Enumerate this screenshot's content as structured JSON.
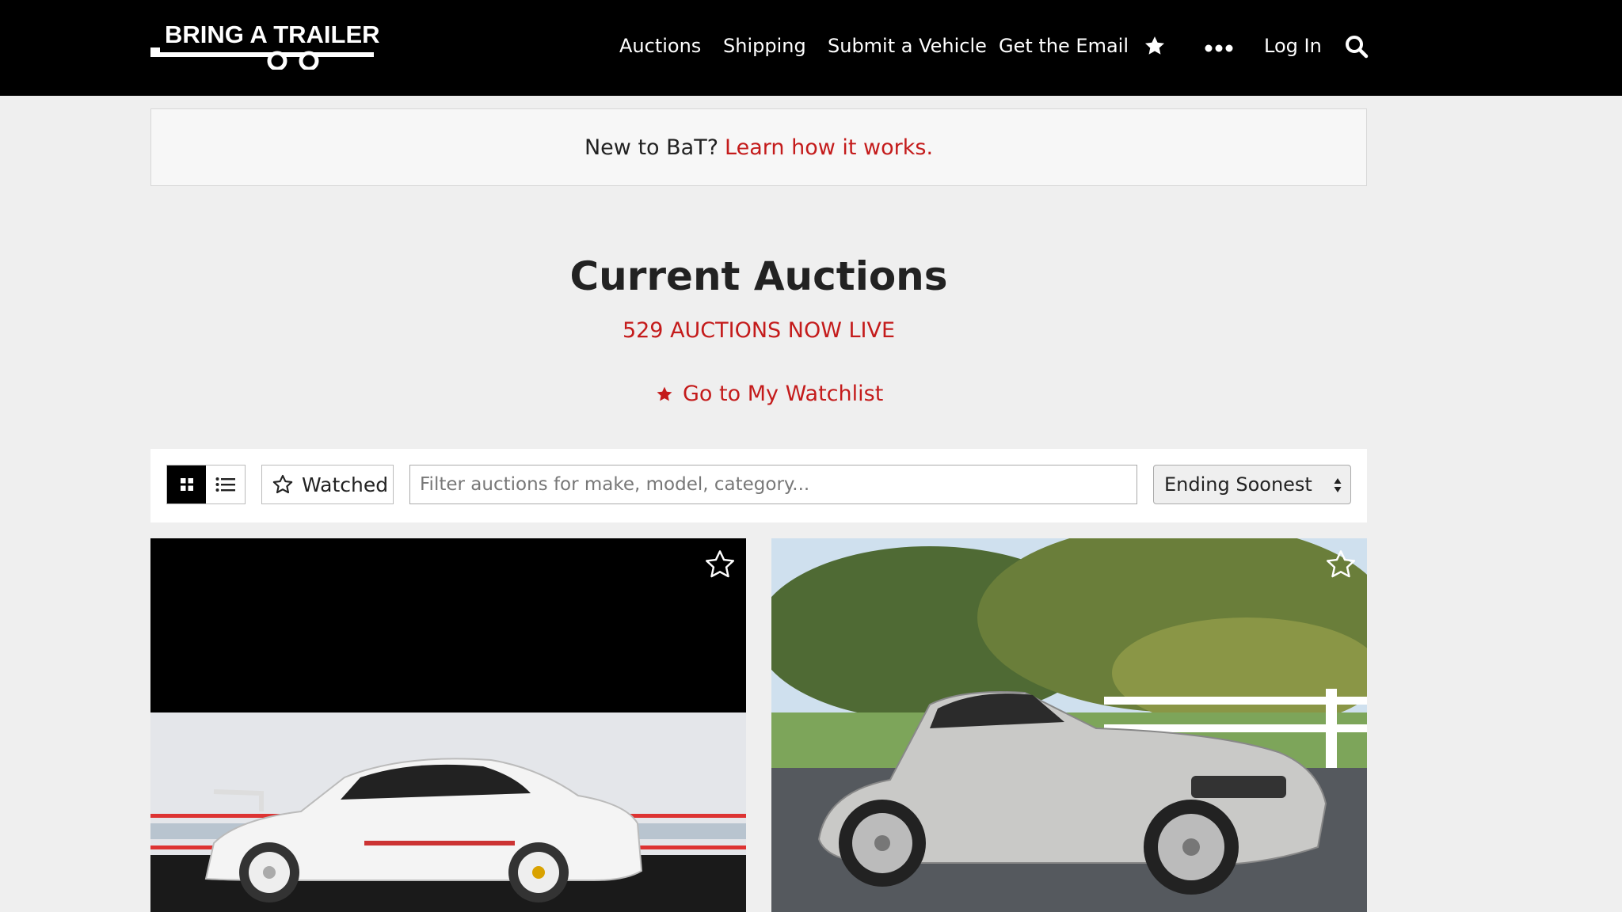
{
  "header": {
    "logo_text": "BRING A TRAILER",
    "nav": [
      {
        "label": "Auctions"
      },
      {
        "label": "Shipping"
      },
      {
        "label": "Submit a Vehicle"
      },
      {
        "label": "Get the Email"
      }
    ],
    "login_label": "Log In",
    "icons": [
      "star-icon",
      "more-icon",
      "search-icon"
    ]
  },
  "banner": {
    "text": "New to BaT?",
    "link": "Learn how it works."
  },
  "main": {
    "title": "Current Auctions",
    "live_count": "529 AUCTIONS NOW LIVE",
    "watchlist_link": "Go to My Watchlist"
  },
  "filters": {
    "watched_label": "Watched",
    "search_placeholder": "Filter auctions for make, model, category...",
    "sort_selected": "Ending Soonest"
  },
  "colors": {
    "accent": "#c41b1b",
    "header_bg": "#000000",
    "page_bg": "#efefef"
  }
}
